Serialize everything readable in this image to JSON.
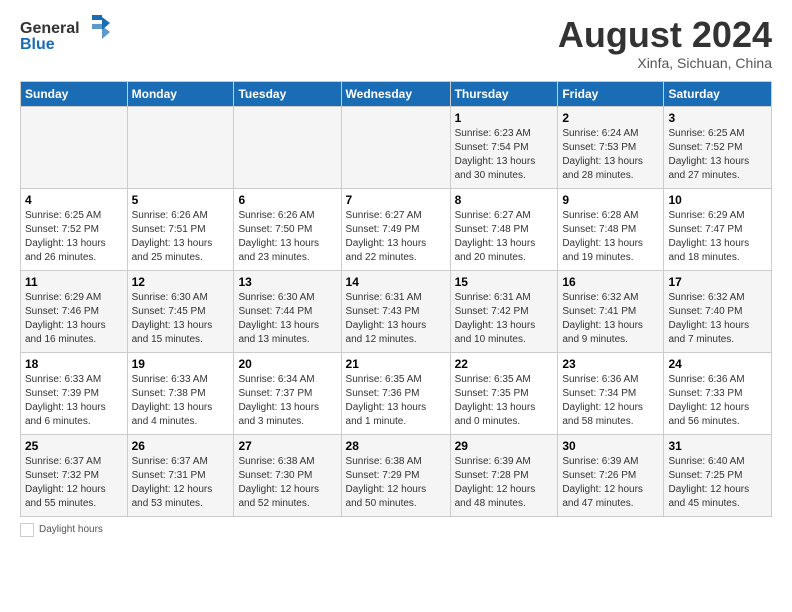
{
  "header": {
    "logo_line1": "General",
    "logo_line2": "Blue",
    "month_title": "August 2024",
    "location": "Xinfa, Sichuan, China"
  },
  "days_of_week": [
    "Sunday",
    "Monday",
    "Tuesday",
    "Wednesday",
    "Thursday",
    "Friday",
    "Saturday"
  ],
  "weeks": [
    [
      {
        "day": "",
        "info": ""
      },
      {
        "day": "",
        "info": ""
      },
      {
        "day": "",
        "info": ""
      },
      {
        "day": "",
        "info": ""
      },
      {
        "day": "1",
        "info": "Sunrise: 6:23 AM\nSunset: 7:54 PM\nDaylight: 13 hours\nand 30 minutes."
      },
      {
        "day": "2",
        "info": "Sunrise: 6:24 AM\nSunset: 7:53 PM\nDaylight: 13 hours\nand 28 minutes."
      },
      {
        "day": "3",
        "info": "Sunrise: 6:25 AM\nSunset: 7:52 PM\nDaylight: 13 hours\nand 27 minutes."
      }
    ],
    [
      {
        "day": "4",
        "info": "Sunrise: 6:25 AM\nSunset: 7:52 PM\nDaylight: 13 hours\nand 26 minutes."
      },
      {
        "day": "5",
        "info": "Sunrise: 6:26 AM\nSunset: 7:51 PM\nDaylight: 13 hours\nand 25 minutes."
      },
      {
        "day": "6",
        "info": "Sunrise: 6:26 AM\nSunset: 7:50 PM\nDaylight: 13 hours\nand 23 minutes."
      },
      {
        "day": "7",
        "info": "Sunrise: 6:27 AM\nSunset: 7:49 PM\nDaylight: 13 hours\nand 22 minutes."
      },
      {
        "day": "8",
        "info": "Sunrise: 6:27 AM\nSunset: 7:48 PM\nDaylight: 13 hours\nand 20 minutes."
      },
      {
        "day": "9",
        "info": "Sunrise: 6:28 AM\nSunset: 7:48 PM\nDaylight: 13 hours\nand 19 minutes."
      },
      {
        "day": "10",
        "info": "Sunrise: 6:29 AM\nSunset: 7:47 PM\nDaylight: 13 hours\nand 18 minutes."
      }
    ],
    [
      {
        "day": "11",
        "info": "Sunrise: 6:29 AM\nSunset: 7:46 PM\nDaylight: 13 hours\nand 16 minutes."
      },
      {
        "day": "12",
        "info": "Sunrise: 6:30 AM\nSunset: 7:45 PM\nDaylight: 13 hours\nand 15 minutes."
      },
      {
        "day": "13",
        "info": "Sunrise: 6:30 AM\nSunset: 7:44 PM\nDaylight: 13 hours\nand 13 minutes."
      },
      {
        "day": "14",
        "info": "Sunrise: 6:31 AM\nSunset: 7:43 PM\nDaylight: 13 hours\nand 12 minutes."
      },
      {
        "day": "15",
        "info": "Sunrise: 6:31 AM\nSunset: 7:42 PM\nDaylight: 13 hours\nand 10 minutes."
      },
      {
        "day": "16",
        "info": "Sunrise: 6:32 AM\nSunset: 7:41 PM\nDaylight: 13 hours\nand 9 minutes."
      },
      {
        "day": "17",
        "info": "Sunrise: 6:32 AM\nSunset: 7:40 PM\nDaylight: 13 hours\nand 7 minutes."
      }
    ],
    [
      {
        "day": "18",
        "info": "Sunrise: 6:33 AM\nSunset: 7:39 PM\nDaylight: 13 hours\nand 6 minutes."
      },
      {
        "day": "19",
        "info": "Sunrise: 6:33 AM\nSunset: 7:38 PM\nDaylight: 13 hours\nand 4 minutes."
      },
      {
        "day": "20",
        "info": "Sunrise: 6:34 AM\nSunset: 7:37 PM\nDaylight: 13 hours\nand 3 minutes."
      },
      {
        "day": "21",
        "info": "Sunrise: 6:35 AM\nSunset: 7:36 PM\nDaylight: 13 hours\nand 1 minute."
      },
      {
        "day": "22",
        "info": "Sunrise: 6:35 AM\nSunset: 7:35 PM\nDaylight: 13 hours\nand 0 minutes."
      },
      {
        "day": "23",
        "info": "Sunrise: 6:36 AM\nSunset: 7:34 PM\nDaylight: 12 hours\nand 58 minutes."
      },
      {
        "day": "24",
        "info": "Sunrise: 6:36 AM\nSunset: 7:33 PM\nDaylight: 12 hours\nand 56 minutes."
      }
    ],
    [
      {
        "day": "25",
        "info": "Sunrise: 6:37 AM\nSunset: 7:32 PM\nDaylight: 12 hours\nand 55 minutes."
      },
      {
        "day": "26",
        "info": "Sunrise: 6:37 AM\nSunset: 7:31 PM\nDaylight: 12 hours\nand 53 minutes."
      },
      {
        "day": "27",
        "info": "Sunrise: 6:38 AM\nSunset: 7:30 PM\nDaylight: 12 hours\nand 52 minutes."
      },
      {
        "day": "28",
        "info": "Sunrise: 6:38 AM\nSunset: 7:29 PM\nDaylight: 12 hours\nand 50 minutes."
      },
      {
        "day": "29",
        "info": "Sunrise: 6:39 AM\nSunset: 7:28 PM\nDaylight: 12 hours\nand 48 minutes."
      },
      {
        "day": "30",
        "info": "Sunrise: 6:39 AM\nSunset: 7:26 PM\nDaylight: 12 hours\nand 47 minutes."
      },
      {
        "day": "31",
        "info": "Sunrise: 6:40 AM\nSunset: 7:25 PM\nDaylight: 12 hours\nand 45 minutes."
      }
    ]
  ],
  "footer": {
    "daylight_label": "Daylight hours"
  },
  "colors": {
    "header_bg": "#1a6db5",
    "header_text": "#ffffff",
    "row_odd": "#f5f5f5",
    "row_even": "#ffffff"
  }
}
